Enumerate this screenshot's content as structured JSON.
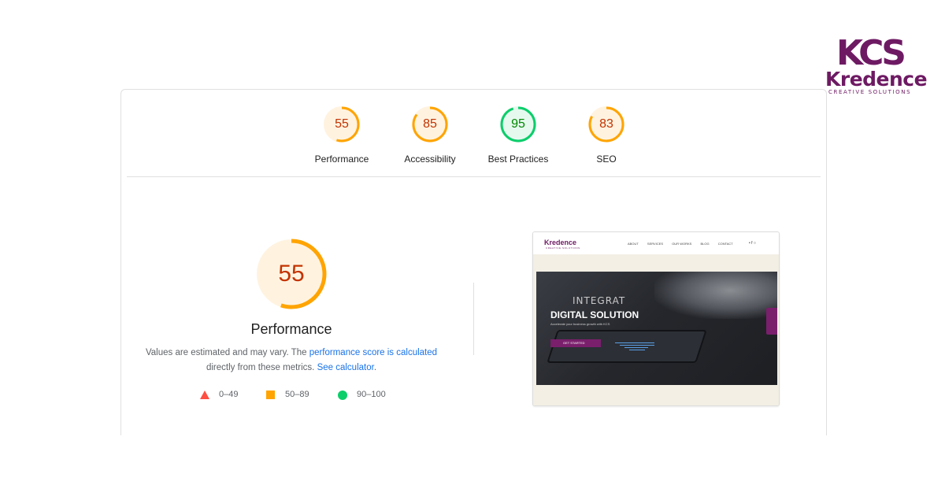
{
  "brand": {
    "mark": "KCS",
    "name": "Kredence",
    "tagline": "CREATIVE SOLUTIONS",
    "color": "#6e1a63"
  },
  "categories": [
    {
      "label": "Performance",
      "score": 55,
      "status": "average",
      "color": "#ffa400",
      "text_color": "#c33300",
      "bg": "#fff3e0"
    },
    {
      "label": "Accessibility",
      "score": 85,
      "status": "average",
      "color": "#ffa400",
      "text_color": "#c33300",
      "bg": "#fff3e0"
    },
    {
      "label": "Best Practices",
      "score": 95,
      "status": "pass",
      "color": "#0cce6b",
      "text_color": "#008800",
      "bg": "#e6f9ef"
    },
    {
      "label": "SEO",
      "score": 83,
      "status": "average",
      "color": "#ffa400",
      "text_color": "#c33300",
      "bg": "#fff3e0"
    }
  ],
  "main": {
    "score": 55,
    "title": "Performance",
    "desc_before": "Values are estimated and may vary. The ",
    "desc_link1": "performance score is calculated",
    "desc_middle": " directly from these metrics. ",
    "desc_link2": "See calculator",
    "desc_end": "."
  },
  "legend": [
    {
      "range": "0–49",
      "shape": "triangle-icon",
      "color": "#ff4e42"
    },
    {
      "range": "50–89",
      "shape": "square-icon",
      "color": "#ffa400"
    },
    {
      "range": "90–100",
      "shape": "circle-icon",
      "color": "#0cce6b"
    }
  ],
  "screenshot": {
    "logo": "Kredence",
    "logo_sub": "CREATIVE SOLUTIONS",
    "nav_links": [
      "ABOUT",
      "SERVICES",
      "OUR WORKS",
      "BLOG",
      "CONTACT"
    ],
    "social": "•  f  ○",
    "hero_word": "INTEGRAT",
    "hero_title": "DIGITAL SOLUTION",
    "hero_sub": "Accelerate your business growth with KCS",
    "cta": "GET STARTED"
  }
}
